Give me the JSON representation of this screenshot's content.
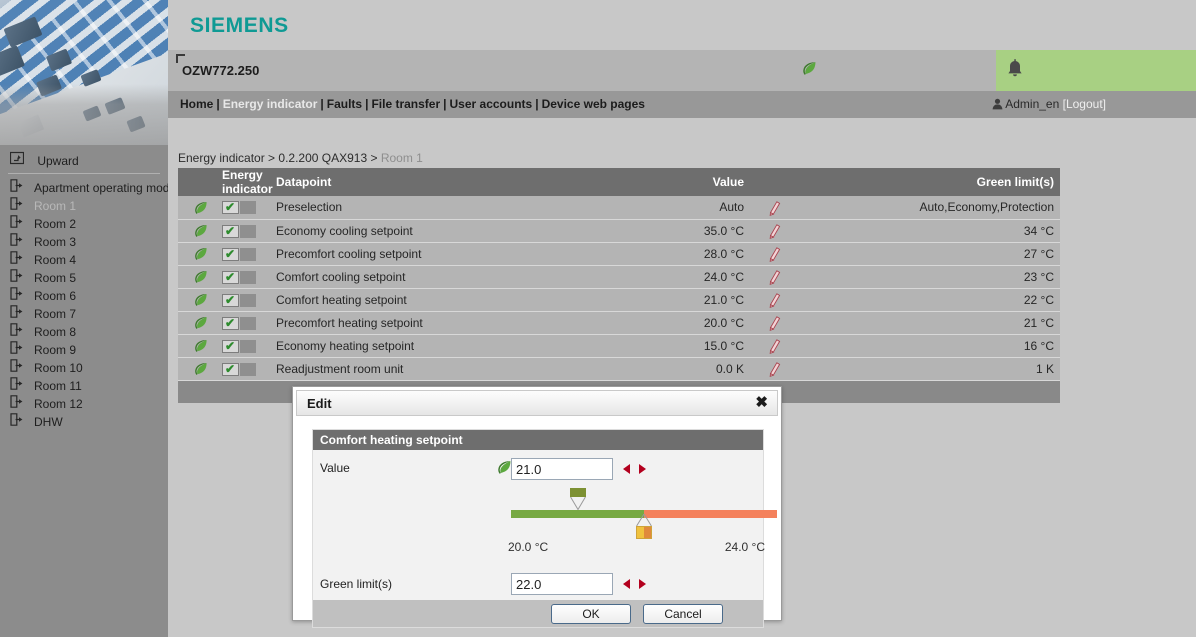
{
  "brand": {
    "logo_text": "SIEMENS"
  },
  "header": {
    "device_name": "OZW772.250",
    "leaf_icon": "leaf-icon",
    "bell_icon": "bell-icon",
    "green_bar_color": "#a8d083"
  },
  "nav": {
    "items": [
      {
        "label": "Home",
        "active": false
      },
      {
        "label": "Energy indicator",
        "active": true
      },
      {
        "label": "Faults",
        "active": false
      },
      {
        "label": "File transfer",
        "active": false
      },
      {
        "label": "User accounts",
        "active": false
      },
      {
        "label": "Device web pages",
        "active": false
      }
    ],
    "separator": "|",
    "user_icon": "user-icon",
    "user_name": "Admin_en",
    "logout_label": "[Logout]"
  },
  "sidebar": {
    "upward": {
      "label": "Upward",
      "icon": "upward-icon"
    },
    "items": [
      {
        "label": "Apartment operating mode",
        "icon": "page-arrow-icon",
        "selected": false
      },
      {
        "label": "Room 1",
        "icon": "page-arrow-icon",
        "selected": true
      },
      {
        "label": "Room 2",
        "icon": "page-arrow-icon",
        "selected": false
      },
      {
        "label": "Room 3",
        "icon": "page-arrow-icon",
        "selected": false
      },
      {
        "label": "Room 4",
        "icon": "page-arrow-icon",
        "selected": false
      },
      {
        "label": "Room 5",
        "icon": "page-arrow-icon",
        "selected": false
      },
      {
        "label": "Room 6",
        "icon": "page-arrow-icon",
        "selected": false
      },
      {
        "label": "Room 7",
        "icon": "page-arrow-icon",
        "selected": false
      },
      {
        "label": "Room 8",
        "icon": "page-arrow-icon",
        "selected": false
      },
      {
        "label": "Room 9",
        "icon": "page-arrow-icon",
        "selected": false
      },
      {
        "label": "Room 10",
        "icon": "page-arrow-icon",
        "selected": false
      },
      {
        "label": "Room 11",
        "icon": "page-arrow-icon",
        "selected": false
      },
      {
        "label": "Room 12",
        "icon": "page-arrow-icon",
        "selected": false
      },
      {
        "label": "DHW",
        "icon": "page-arrow-icon",
        "selected": false
      }
    ]
  },
  "breadcrumb": {
    "part1": "Energy indicator",
    "sep1": " > ",
    "part2": "0.2.200 QAX913",
    "sep2": " > ",
    "current": "Room 1"
  },
  "table": {
    "headers": {
      "energy_indicator": "Energy indicator",
      "datapoint": "Datapoint",
      "value": "Value",
      "green_limits": "Green limit(s)"
    },
    "rows": [
      {
        "datapoint": "Preselection",
        "value": "Auto",
        "green_limit": "Auto,Economy,Protection",
        "checked": true,
        "leaf": "leaf-icon",
        "pencil": "pencil-icon"
      },
      {
        "datapoint": "Economy cooling setpoint",
        "value": "35.0 °C",
        "green_limit": "34 °C",
        "checked": true,
        "leaf": "leaf-icon",
        "pencil": "pencil-icon"
      },
      {
        "datapoint": "Precomfort cooling setpoint",
        "value": "28.0 °C",
        "green_limit": "27 °C",
        "checked": true,
        "leaf": "leaf-icon",
        "pencil": "pencil-icon"
      },
      {
        "datapoint": "Comfort cooling setpoint",
        "value": "24.0 °C",
        "green_limit": "23 °C",
        "checked": true,
        "leaf": "leaf-icon",
        "pencil": "pencil-icon"
      },
      {
        "datapoint": "Comfort heating setpoint",
        "value": "21.0 °C",
        "green_limit": "22 °C",
        "checked": true,
        "leaf": "leaf-icon",
        "pencil": "pencil-icon"
      },
      {
        "datapoint": "Precomfort heating setpoint",
        "value": "20.0 °C",
        "green_limit": "21 °C",
        "checked": true,
        "leaf": "leaf-icon",
        "pencil": "pencil-icon"
      },
      {
        "datapoint": "Economy heating setpoint",
        "value": "15.0 °C",
        "green_limit": "16 °C",
        "checked": true,
        "leaf": "leaf-icon",
        "pencil": "pencil-icon"
      },
      {
        "datapoint": "Readjustment room unit",
        "value": "0.0 K",
        "green_limit": "1 K",
        "checked": true,
        "leaf": "leaf-icon",
        "pencil": "pencil-icon"
      }
    ]
  },
  "dialog": {
    "title": "Edit",
    "close_icon": "close-icon",
    "section_title": "Comfort heating setpoint",
    "value_label": "Value",
    "value_input": "21.0",
    "value_leaf_icon": "leaf-icon",
    "limit_label": "Green limit(s)",
    "limit_input": "22.0",
    "range_min_label": "20.0 °C",
    "range_max_label": "24.0 °C",
    "slider": {
      "min": 20.0,
      "max": 24.0,
      "value": 21.0,
      "green_limit": 22.0,
      "green_color": "#77a943",
      "orange_color": "#f4815c"
    },
    "ok_label": "OK",
    "cancel_label": "Cancel",
    "prev_arrow_icon": "arrow-left-icon",
    "next_arrow_icon": "arrow-right-icon"
  }
}
